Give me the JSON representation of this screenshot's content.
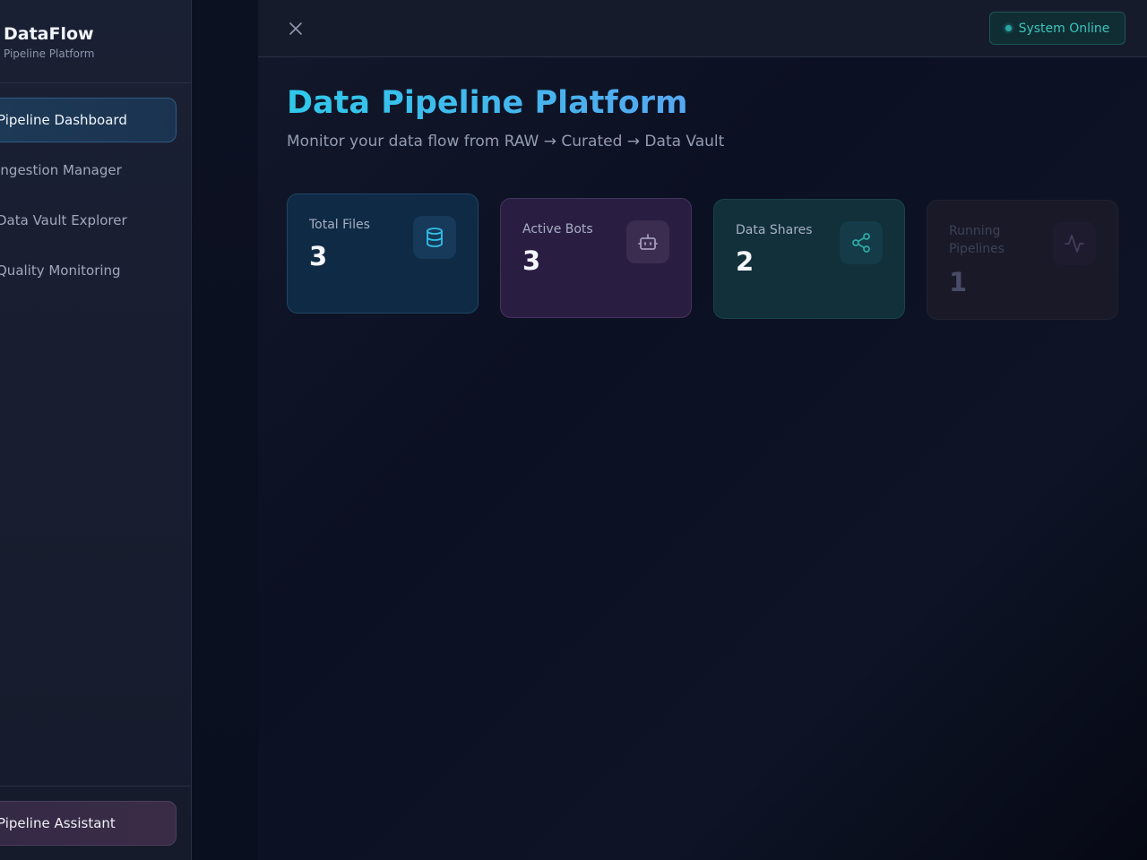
{
  "sidebar": {
    "brand_title": "DataFlow",
    "brand_subtitle": "Pipeline Platform",
    "items": [
      {
        "label": "Pipeline Dashboard",
        "active": true
      },
      {
        "label": "Ingestion Manager",
        "active": false
      },
      {
        "label": "Data Vault Explorer",
        "active": false
      },
      {
        "label": "Quality Monitoring",
        "active": false
      }
    ],
    "assistant_label": "Pipeline Assistant"
  },
  "topbar": {
    "close_icon": "close-icon",
    "status_label": "System Online",
    "status_color": "#3cc4bd"
  },
  "main": {
    "title": "Data Pipeline Platform",
    "subtitle": "Monitor your data flow from RAW → Curated → Data Vault",
    "cards": [
      {
        "label": "Total Files",
        "value": "3",
        "icon": "database-icon",
        "accent": "#2fc0e8"
      },
      {
        "label": "Active Bots",
        "value": "3",
        "icon": "bot-icon",
        "accent": "#9a8fb0"
      },
      {
        "label": "Data Shares",
        "value": "2",
        "icon": "share-icon",
        "accent": "#2ea8a4"
      },
      {
        "label": "Running Pipelines",
        "value": "1",
        "icon": "activity-icon",
        "accent": "#4a3f62"
      }
    ]
  },
  "colors": {
    "title_gradient_start": "#2fc9ea",
    "title_gradient_end": "#56a8f0",
    "active_nav_bg": "#1c3a57",
    "assistant_bg": "#3a2c47"
  }
}
